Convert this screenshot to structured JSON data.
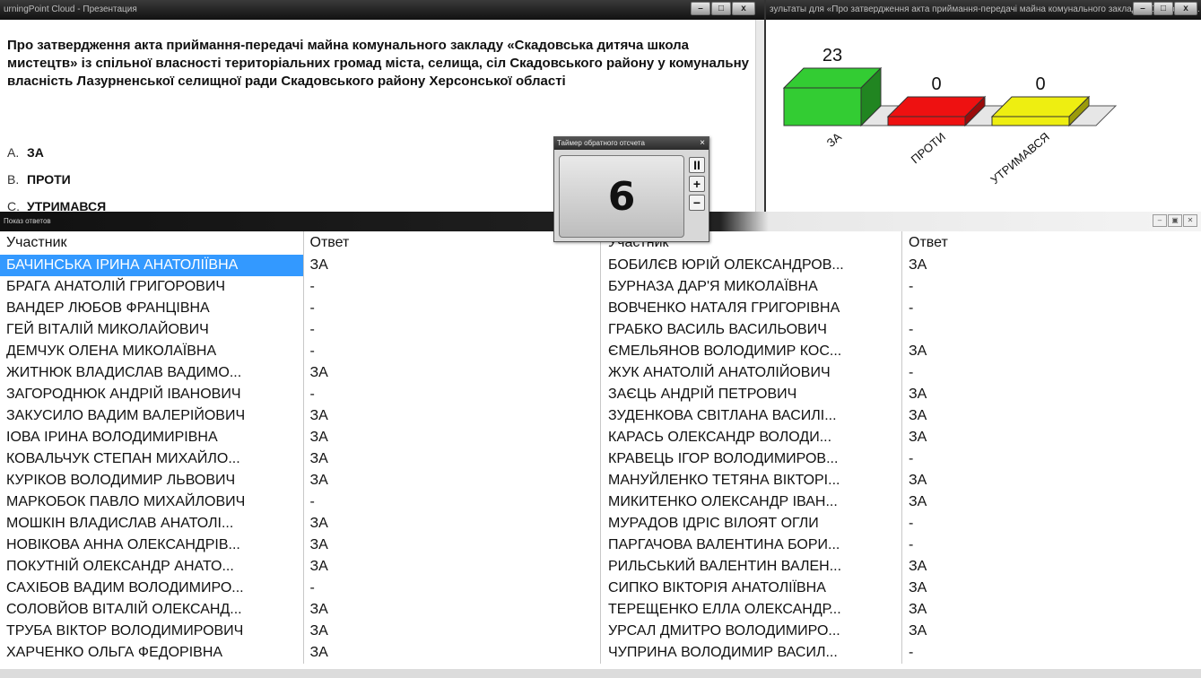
{
  "presentation": {
    "title": "urningPoint Cloud - Презентация",
    "question": "Про затвердження акта приймання-передачі майна комунального закладу «Скадовська дитяча школа мистецтв» із спільної власності територіальних громад міста, селища, сіл Скадовського району у комунальну власність Лазурненської селищної ради Скадовського району Херсонської області",
    "options": [
      {
        "letter": "A.",
        "text": "ЗА"
      },
      {
        "letter": "B.",
        "text": "ПРОТИ"
      },
      {
        "letter": "C.",
        "text": "УТРИМАВСЯ"
      }
    ]
  },
  "results": {
    "title": "зультаты для «Про затвердження акта приймання-передачі майна комунального закладу «Скадовськ..."
  },
  "chart_data": {
    "type": "bar",
    "categories": [
      "ЗА",
      "ПРОТИ",
      "УТРИМАВСЯ"
    ],
    "values": [
      23,
      0,
      0
    ],
    "colors": [
      "#33cc33",
      "#ee1111",
      "#eeee11"
    ],
    "ylim": [
      0,
      23
    ]
  },
  "timer": {
    "title": "Таймер обратного отсчета",
    "value": "6",
    "pause": "II",
    "plus": "+",
    "minus": "−",
    "close": "×"
  },
  "answers": {
    "title": "Показ ответов",
    "headers": {
      "participant": "Участник",
      "answer": "Ответ"
    },
    "left": [
      {
        "name": "БАЧИНСЬКА ІРИНА АНАТОЛІЇВНА",
        "answer": "ЗА"
      },
      {
        "name": "БРАГА АНАТОЛІЙ ГРИГОРОВИЧ",
        "answer": "-"
      },
      {
        "name": "ВАНДЕР ЛЮБОВ ФРАНЦІВНА",
        "answer": "-"
      },
      {
        "name": "ГЕЙ ВІТАЛІЙ МИКОЛАЙОВИЧ",
        "answer": "-"
      },
      {
        "name": "ДЕМЧУК ОЛЕНА МИКОЛАЇВНА",
        "answer": "-"
      },
      {
        "name": "ЖИТНЮК ВЛАДИСЛАВ ВАДИМО...",
        "answer": "ЗА"
      },
      {
        "name": "ЗАГОРОДНЮК АНДРІЙ ІВАНОВИЧ",
        "answer": "-"
      },
      {
        "name": "ЗАКУСИЛО ВАДИМ ВАЛЕРІЙОВИЧ",
        "answer": "ЗА"
      },
      {
        "name": "ІОВА ІРИНА ВОЛОДИМИРІВНА",
        "answer": "ЗА"
      },
      {
        "name": "КОВАЛЬЧУК СТЕПАН МИХАЙЛО...",
        "answer": "ЗА"
      },
      {
        "name": "КУРІКОВ ВОЛОДИМИР ЛЬВОВИЧ",
        "answer": "ЗА"
      },
      {
        "name": "МАРКОБОК ПАВЛО МИХАЙЛОВИЧ",
        "answer": "-"
      },
      {
        "name": "МОШКІН ВЛАДИСЛАВ АНАТОЛІ...",
        "answer": "ЗА"
      },
      {
        "name": "НОВІКОВА АННА ОЛЕКСАНДРІВ...",
        "answer": "ЗА"
      },
      {
        "name": "ПОКУТНІЙ ОЛЕКСАНДР АНАТО...",
        "answer": "ЗА"
      },
      {
        "name": "САХІБОВ ВАДИМ ВОЛОДИМИРО...",
        "answer": "-"
      },
      {
        "name": "СОЛОВЙОВ ВІТАЛІЙ ОЛЕКСАНД...",
        "answer": "ЗА"
      },
      {
        "name": "ТРУБА ВІКТОР ВОЛОДИМИРОВИЧ",
        "answer": "ЗА"
      },
      {
        "name": "ХАРЧЕНКО ОЛЬГА ФЕДОРІВНА",
        "answer": "ЗА"
      }
    ],
    "right": [
      {
        "name": "БОБИЛЄВ ЮРІЙ ОЛЕКСАНДРОВ...",
        "answer": "ЗА"
      },
      {
        "name": "БУРНАЗА ДАР'Я МИКОЛАЇВНА",
        "answer": "-"
      },
      {
        "name": "ВОВЧЕНКО НАТАЛЯ ГРИГОРІВНА",
        "answer": "-"
      },
      {
        "name": "ГРАБКО ВАСИЛЬ ВАСИЛЬОВИЧ",
        "answer": "-"
      },
      {
        "name": "ЄМЕЛЬЯНОВ ВОЛОДИМИР КОС...",
        "answer": "ЗА"
      },
      {
        "name": "ЖУК АНАТОЛІЙ АНАТОЛІЙОВИЧ",
        "answer": "-"
      },
      {
        "name": "ЗАЄЦЬ АНДРІЙ ПЕТРОВИЧ",
        "answer": "ЗА"
      },
      {
        "name": "ЗУДЕНКОВА СВІТЛАНА ВАСИЛІ...",
        "answer": "ЗА"
      },
      {
        "name": "КАРАСЬ ОЛЕКСАНДР ВОЛОДИ...",
        "answer": "ЗА"
      },
      {
        "name": "КРАВЕЦЬ ІГОР ВОЛОДИМИРОВ...",
        "answer": "-"
      },
      {
        "name": "МАНУЙЛЕНКО ТЕТЯНА ВІКТОРІ...",
        "answer": "ЗА"
      },
      {
        "name": "МИКИТЕНКО ОЛЕКСАНДР ІВАН...",
        "answer": "ЗА"
      },
      {
        "name": "МУРАДОВ ІДРІС ВІЛОЯТ ОГЛИ",
        "answer": "-"
      },
      {
        "name": "ПАРГАЧОВА ВАЛЕНТИНА БОРИ...",
        "answer": "-"
      },
      {
        "name": "РИЛЬСЬКИЙ ВАЛЕНТИН ВАЛЕН...",
        "answer": "ЗА"
      },
      {
        "name": "СИПКО ВІКТОРІЯ АНАТОЛІЇВНА",
        "answer": "ЗА"
      },
      {
        "name": "ТЕРЕЩЕНКО ЕЛЛА ОЛЕКСАНДР...",
        "answer": "ЗА"
      },
      {
        "name": "УРСАЛ ДМИТРО ВОЛОДИМИРО...",
        "answer": "ЗА"
      },
      {
        "name": "ЧУПРИНА ВОЛОДИМИР ВАСИЛ...",
        "answer": "-"
      }
    ]
  }
}
